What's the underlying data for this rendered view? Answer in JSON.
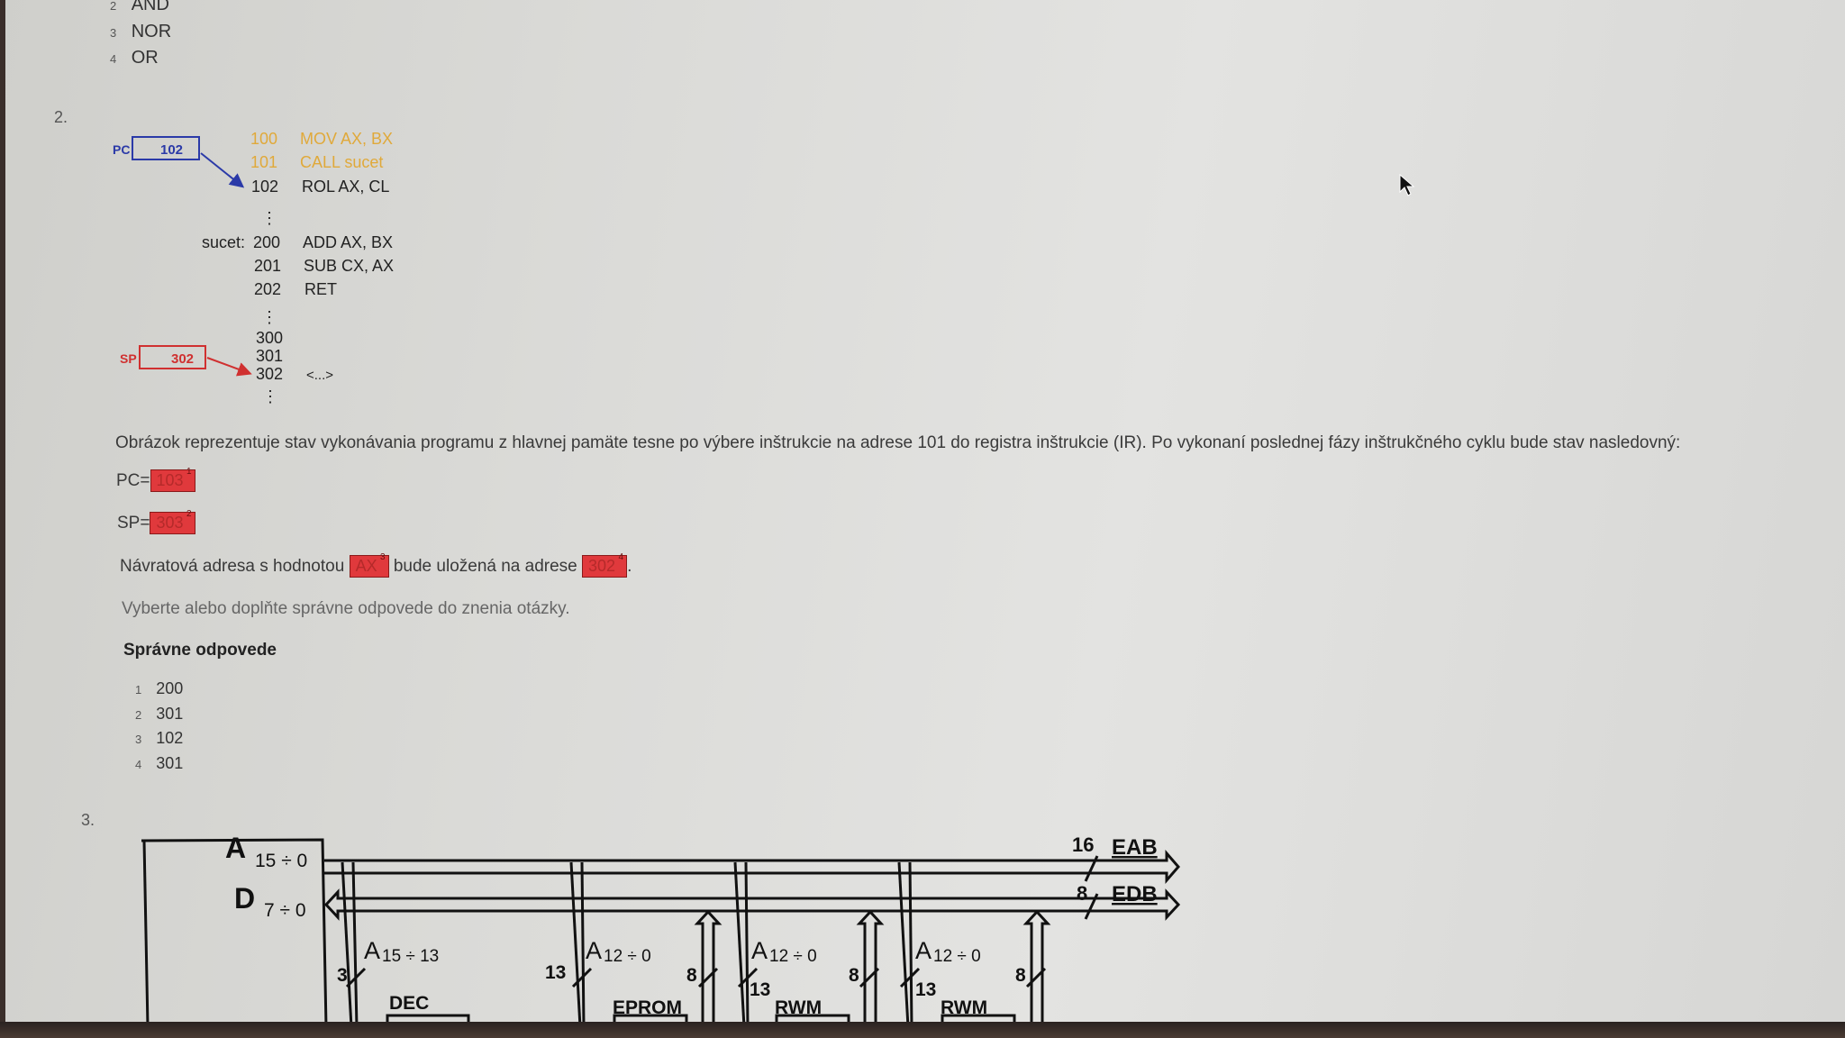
{
  "prev_answers": [
    {
      "n": "2",
      "label": "AND"
    },
    {
      "n": "3",
      "label": "NOR"
    },
    {
      "n": "4",
      "label": "OR"
    }
  ],
  "q2": {
    "number": "2.",
    "figure": {
      "pc_label": "PC",
      "pc_value": "102",
      "sp_label": "SP",
      "sp_value": "302",
      "sucet_label": "sucet:",
      "memory": [
        {
          "addr": "100",
          "instr": "MOV AX, BX",
          "color": "#e0a93a"
        },
        {
          "addr": "101",
          "instr": "CALL sucet",
          "color": "#e0a93a"
        },
        {
          "addr": "102",
          "instr": "ROL AX, CL",
          "color": "#222222"
        },
        {
          "addr": "200",
          "instr": "ADD AX, BX",
          "color": "#222222"
        },
        {
          "addr": "201",
          "instr": "SUB CX, AX",
          "color": "#222222"
        },
        {
          "addr": "202",
          "instr": "RET",
          "color": "#222222"
        },
        {
          "addr": "300",
          "instr": "",
          "color": "#222222"
        },
        {
          "addr": "301",
          "instr": "",
          "color": "#222222"
        },
        {
          "addr": "302",
          "instr": "<...>",
          "color": "#222222"
        }
      ],
      "pc_color": "#2b3aa8",
      "sp_color": "#d03030"
    },
    "question": "Obrázok reprezentuje stav vykonávania programu z hlavnej pamäte tesne po výbere inštrukcie na adrese 101 do registra inštrukcie (IR). Po vykonaní poslednej fázy inštrukčného cyklu bude stav nasledovný:",
    "pc_prefix": "PC=",
    "pc_blank": "103",
    "pc_blank_n": "1",
    "sp_prefix": "SP=",
    "sp_blank": "303",
    "sp_blank_n": "2",
    "ret_prefix": "Návratová adresa s hodnotou",
    "ret_blank": "AX",
    "ret_blank_n": "3",
    "ret_mid": "bude uložená na adrese",
    "addr_blank": "302",
    "addr_blank_n": "4",
    "ret_end": ".",
    "instruction": "Vyberte alebo doplňte správne odpovede do znenia otázky.",
    "correct_title": "Správne odpovede",
    "correct": [
      {
        "n": "1",
        "v": "200"
      },
      {
        "n": "2",
        "v": "301"
      },
      {
        "n": "3",
        "v": "102"
      },
      {
        "n": "4",
        "v": "301"
      }
    ],
    "blank_color": "#e0393c"
  },
  "q3": {
    "number": "3.",
    "labels": {
      "a": "A",
      "a_sub": "15 ÷ 0",
      "d": "D",
      "d_sub": "7 ÷ 0",
      "eab_w": "16",
      "eab": "EAB",
      "edb_w": "8",
      "edb": "EDB",
      "a1513": "A",
      "a1513_sub": "15 ÷ 13",
      "w3": "3",
      "a120": "A",
      "a120_sub": "12 ÷ 0",
      "w13": "13",
      "w8": "8",
      "dec": "DEC",
      "eprom": "EPROM",
      "rwm": "RWM"
    }
  }
}
